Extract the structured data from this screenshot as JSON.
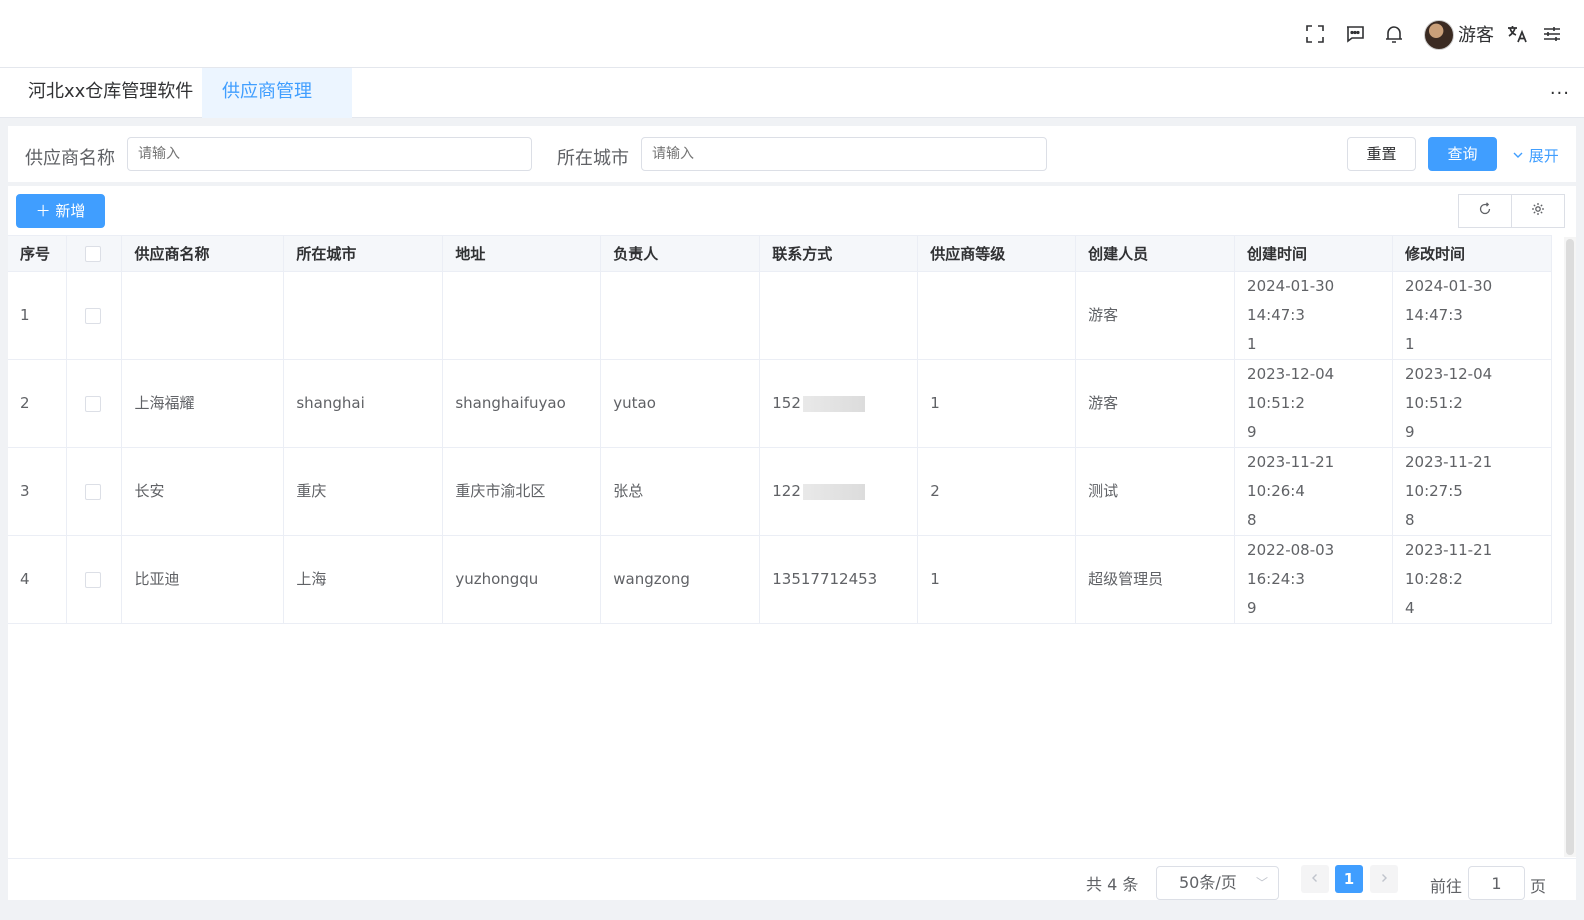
{
  "header": {
    "user_name": "游客"
  },
  "tabs": [
    {
      "label": "河北xx仓库管理软件"
    },
    {
      "label": "供应商管理",
      "close": "×"
    }
  ],
  "tab_more": "···",
  "search": {
    "supplier_label": "供应商名称",
    "supplier_placeholder": "请输入",
    "city_label": "所在城市",
    "city_placeholder": "请输入",
    "reset": "重置",
    "query": "查询",
    "expand": "展开"
  },
  "toolbar": {
    "add": "新增"
  },
  "table": {
    "columns": [
      "序号",
      "供应商名称",
      "所在城市",
      "地址",
      "负责人",
      "联系方式",
      "供应商等级",
      "创建人员",
      "创建时间",
      "修改时间"
    ],
    "rows": [
      {
        "idx": "1",
        "name": "",
        "city": "",
        "addr": "",
        "owner": "",
        "contact": "",
        "level": "",
        "creator": "游客",
        "created": "2024-01-30 14:47:3",
        "created2": "1",
        "modified": "2024-01-30 14:47:3",
        "modified2": "1"
      },
      {
        "idx": "2",
        "name": "上海福耀",
        "city": "shanghai",
        "addr": "shanghaifuyao",
        "owner": "yutao",
        "contact": "152",
        "level": "1",
        "creator": "游客",
        "created": "2023-12-04 10:51:2",
        "created2": "9",
        "modified": "2023-12-04 10:51:2",
        "modified2": "9"
      },
      {
        "idx": "3",
        "name": "长安",
        "city": "重庆",
        "addr": "重庆市渝北区",
        "owner": "张总",
        "contact": "122",
        "level": "2",
        "creator": "测试",
        "created": "2023-11-21 10:26:4",
        "created2": "8",
        "modified": "2023-11-21 10:27:5",
        "modified2": "8"
      },
      {
        "idx": "4",
        "name": "比亚迪",
        "city": "上海",
        "addr": "yuzhongqu",
        "owner": "wangzong",
        "contact": "13517712453",
        "level": "1",
        "creator": "超级管理员",
        "created": "2022-08-03 16:24:3",
        "created2": "9",
        "modified": "2023-11-21 10:28:2",
        "modified2": "4"
      }
    ]
  },
  "pager": {
    "total": "共 4 条",
    "size": "50条/页",
    "current": "1",
    "goto_prefix": "前往",
    "goto_value": "1",
    "goto_suffix": "页"
  }
}
